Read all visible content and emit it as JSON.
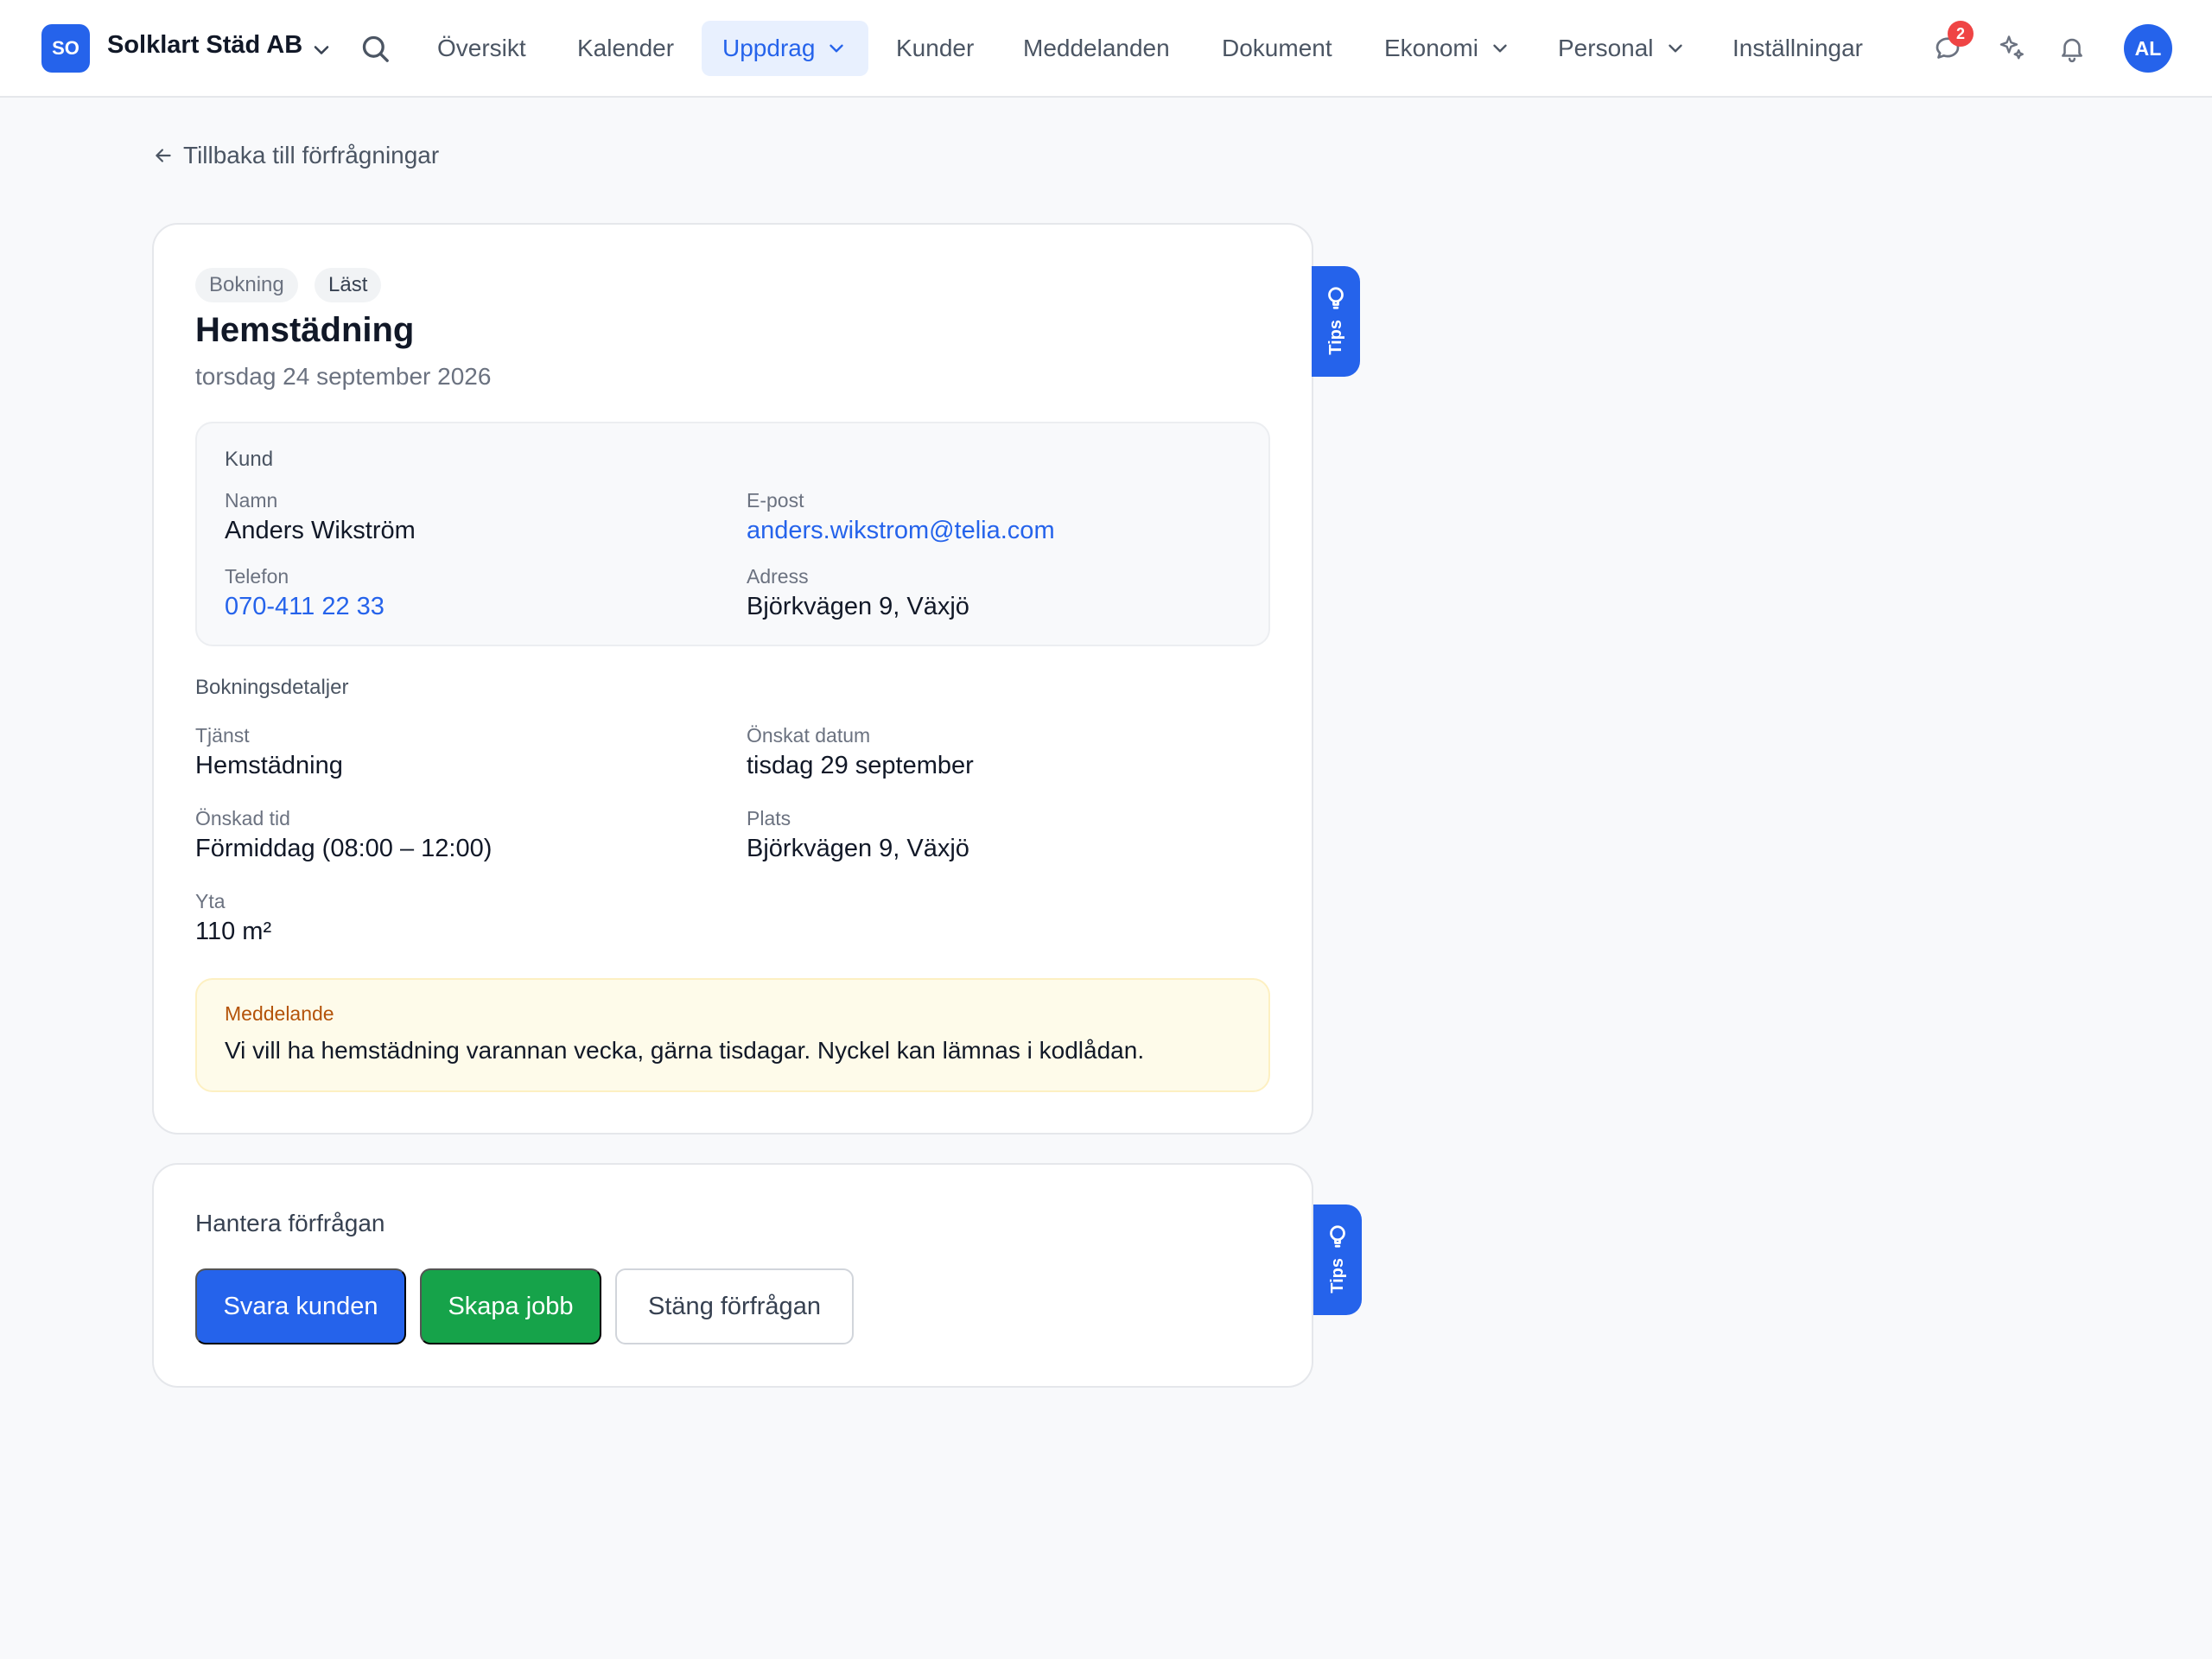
{
  "topbar": {
    "logo_initials": "SO",
    "company_name": "Solklart Städ AB",
    "nav": [
      {
        "label": "Översikt"
      },
      {
        "label": "Kalender"
      },
      {
        "label": "Uppdrag",
        "active": true
      },
      {
        "label": "Kunder"
      },
      {
        "label": "Meddelanden"
      },
      {
        "label": "Dokument"
      },
      {
        "label": "Ekonomi"
      },
      {
        "label": "Personal"
      },
      {
        "label": "Inställningar"
      }
    ],
    "messages_badge": "2",
    "avatar_initials": "AL",
    "accent": "#2563eb",
    "badge_color": "#ef4444"
  },
  "back_link": "Tillbaka till förfrågningar",
  "request": {
    "type_tag": "Bokning",
    "status_tag": "Läst",
    "title": "Hemstädning",
    "date": "torsdag 24 september 2026"
  },
  "customer": {
    "section_title": "Kund",
    "name_label": "Namn",
    "name": "Anders Wikström",
    "email_label": "E-post",
    "email": "anders.wikstrom@telia.com",
    "phone_label": "Telefon",
    "phone": "070-411 22 33",
    "address_label": "Adress",
    "address": "Björkvägen 9, Växjö"
  },
  "booking": {
    "section_title": "Bokningsdetaljer",
    "service_label": "Tjänst",
    "service": "Hemstädning",
    "date_label": "Önskat datum",
    "date": "tisdag 29 september",
    "time_label": "Önskad tid",
    "time": "Förmiddag (08:00 – 12:00)",
    "place_label": "Plats",
    "place": "Björkvägen 9, Växjö",
    "area_label": "Yta",
    "area": "110 m²"
  },
  "message": {
    "label": "Meddelande",
    "text": "Vi vill ha hemstädning varannan vecka, gärna tisdagar. Nyckel kan lämnas i kodlådan."
  },
  "actions": {
    "title": "Hantera förfrågan",
    "reply": "Svara kunden",
    "create_job": "Skapa jobb",
    "close": "Stäng förfrågan"
  },
  "tips_label": "Tips"
}
